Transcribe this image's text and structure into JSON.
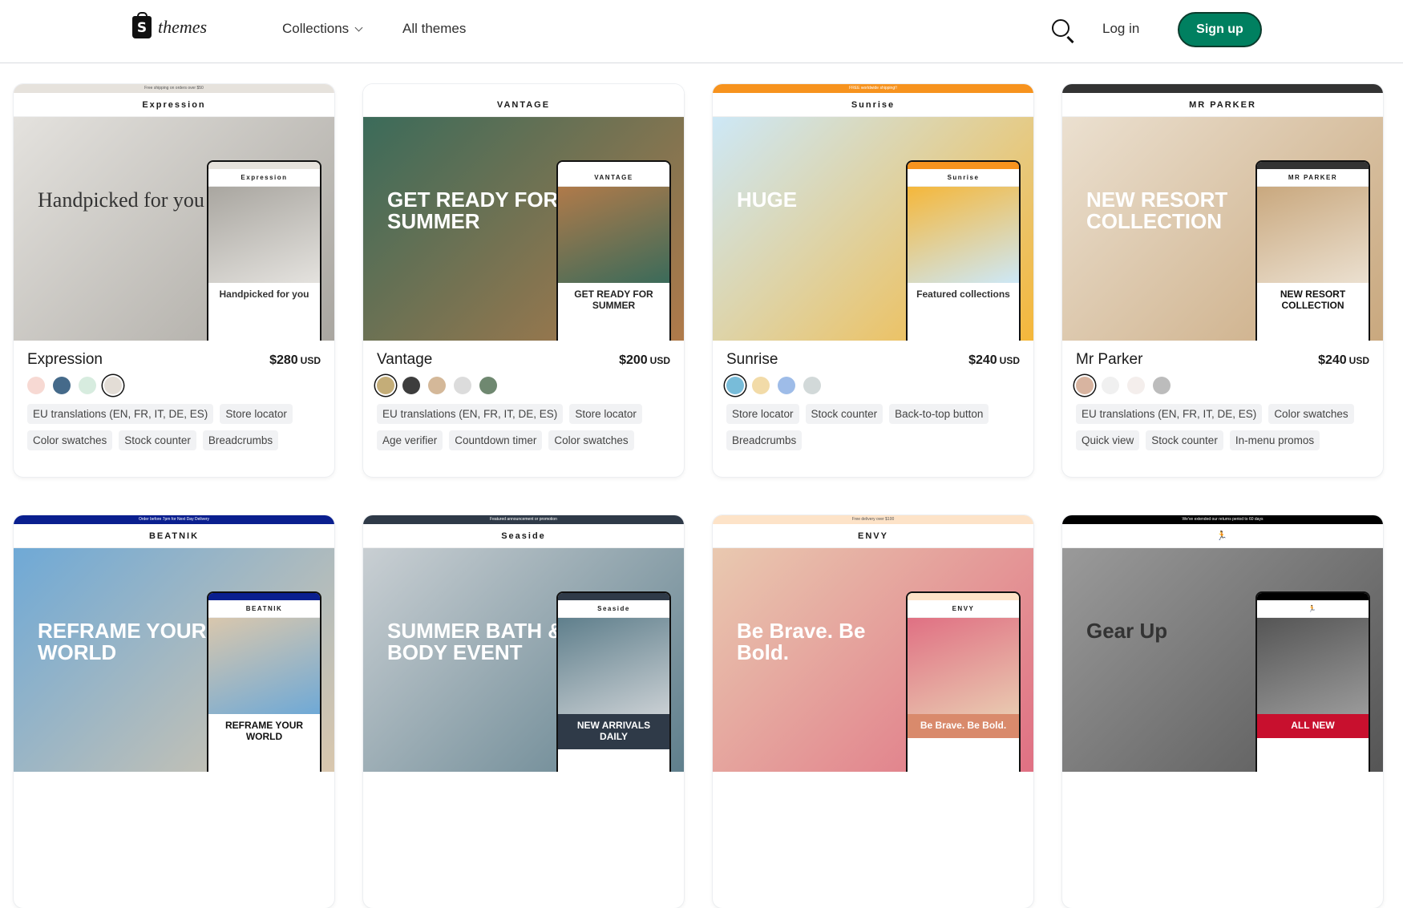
{
  "header": {
    "logo_text": "themes",
    "nav": [
      {
        "label": "Collections"
      },
      {
        "label": "All themes"
      }
    ],
    "login": "Log in",
    "signup": "Sign up",
    "accent": "#008060"
  },
  "themes": [
    {
      "name": "Expression",
      "price": "$280",
      "currency": "USD",
      "swatches": [
        {
          "color": "#f7d9d3"
        },
        {
          "color": "#456a8a"
        },
        {
          "color": "#d7ecdf"
        },
        {
          "color": "#e3ddd6",
          "selected": true
        }
      ],
      "features": [
        "EU translations (EN, FR, IT, DE, ES)",
        "Store locator",
        "Color swatches",
        "Stock counter",
        "Breadcrumbs"
      ],
      "preview": {
        "banner": "Free shipping on orders over $50",
        "brand": "Expression",
        "headline": "Handpicked for you",
        "phone_headline": "Handpicked for you",
        "bar": "#e6e2dc",
        "hero": [
          "#e4e2de",
          "#a9a6a0"
        ],
        "text": "#333333",
        "phone_text": "#333333"
      }
    },
    {
      "name": "Vantage",
      "price": "$200",
      "currency": "USD",
      "swatches": [
        {
          "color": "#c4ad78",
          "selected": true
        },
        {
          "color": "#3d3d3d"
        },
        {
          "color": "#d4b899"
        },
        {
          "color": "#dcdcdc"
        },
        {
          "color": "#6f8870"
        }
      ],
      "features": [
        "EU translations (EN, FR, IT, DE, ES)",
        "Store locator",
        "Age verifier",
        "Countdown timer",
        "Color swatches"
      ],
      "preview": {
        "banner": "",
        "brand": "VANTAGE",
        "headline": "GET READY FOR SUMMER",
        "phone_headline": "GET READY FOR SUMMER",
        "bar": "#ffffff",
        "hero": [
          "#3b6b5a",
          "#b07a4a"
        ],
        "text": "#ffffff",
        "phone_text": "#222222"
      }
    },
    {
      "name": "Sunrise",
      "price": "$240",
      "currency": "USD",
      "swatches": [
        {
          "color": "#78bcd9",
          "selected": true
        },
        {
          "color": "#f2dba8"
        },
        {
          "color": "#9ebce8"
        },
        {
          "color": "#d2d9d9"
        }
      ],
      "features": [
        "Store locator",
        "Stock counter",
        "Back-to-top button",
        "Breadcrumbs"
      ],
      "preview": {
        "banner": "FREE worldwide shipping!!",
        "brand": "Sunrise",
        "headline": "HUGE",
        "phone_headline": "Featured collections",
        "bar": "#f7931e",
        "hero": [
          "#cde8f7",
          "#f5b73a"
        ],
        "text": "#ffffff",
        "phone_text": "#333333"
      }
    },
    {
      "name": "Mr Parker",
      "price": "$240",
      "currency": "USD",
      "swatches": [
        {
          "color": "#d8b4a0",
          "selected": true
        },
        {
          "color": "#f0f0f0"
        },
        {
          "color": "#f4eeec"
        },
        {
          "color": "#bcbcbc"
        }
      ],
      "features": [
        "EU translations (EN, FR, IT, DE, ES)",
        "Color swatches",
        "Quick view",
        "Stock counter",
        "In-menu promos"
      ],
      "preview": {
        "banner": "",
        "brand": "MR PARKER",
        "headline": "NEW RESORT COLLECTION",
        "phone_headline": "NEW RESORT COLLECTION",
        "bar": "#333333",
        "hero": [
          "#ebe0d0",
          "#c9a87e"
        ],
        "text": "#ffffff",
        "phone_text": "#111111"
      }
    },
    {
      "preview": {
        "banner": "Order before 7pm for Next Day Delivery",
        "brand": "BEATNIK",
        "headline": "REFRAME YOUR WORLD",
        "phone_headline": "REFRAME YOUR WORLD",
        "bar": "#0a1f8f",
        "hero": [
          "#6fa9d6",
          "#d9c7ad"
        ],
        "text": "#ffffff",
        "phone_text": "#111111"
      }
    },
    {
      "preview": {
        "banner": "Featured announcement or promotion",
        "brand": "Seaside",
        "headline": "SUMMER BATH & BODY EVENT",
        "phone_headline": "NEW ARRIVALS DAILY",
        "bar": "#2f3a48",
        "hero": [
          "#c9cfd3",
          "#5f7f8c"
        ],
        "text": "#ffffff",
        "phone_text": "#ffffff"
      }
    },
    {
      "preview": {
        "banner": "Free delivery over $100",
        "brand": "ENVY",
        "headline": "Be Brave. Be Bold.",
        "phone_headline": "Be Brave. Be Bold.",
        "bar": "#fde3c8",
        "hero": [
          "#e9c9b0",
          "#e07083"
        ],
        "text": "#ffffff",
        "phone_text": "#ffffff"
      }
    },
    {
      "preview": {
        "banner": "We've extended our returns period to 60 days",
        "brand": "🏃",
        "headline": "Gear Up",
        "phone_headline": "ALL NEW",
        "bar": "#000000",
        "hero": [
          "#9a9a9a",
          "#555555"
        ],
        "text": "#333333",
        "phone_text": "#ffffff"
      }
    }
  ]
}
